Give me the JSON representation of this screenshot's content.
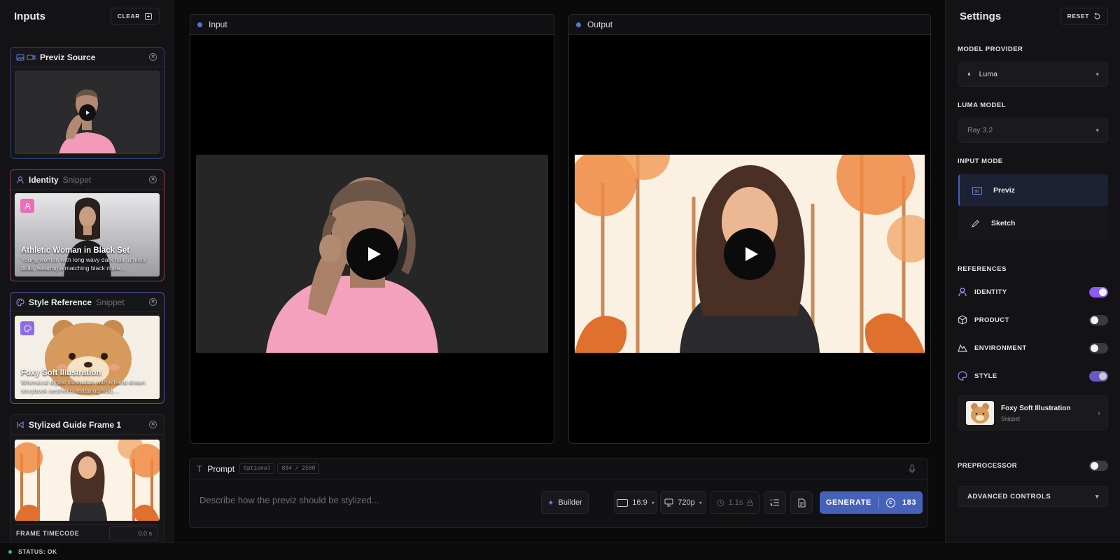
{
  "left": {
    "title": "Inputs",
    "clear_label": "CLEAR",
    "previz_card": {
      "title": "Previz Source"
    },
    "identity_card": {
      "title": "Identity",
      "tag": "Snippet",
      "name": "Athletic Woman in Black Set",
      "desc": "Young woman with long wavy dark hair, athletic build, wearing a matching black ribbe..."
    },
    "style_card": {
      "title": "Style Reference",
      "tag": "Snippet",
      "name": "Foxy Soft Illustration",
      "desc": "Whimsical digital illustration with a hand-drawn storybook aesthetic, featuring fluid,..."
    },
    "guide_card": {
      "title": "Stylized Guide Frame 1",
      "timecode_label": "FRAME TIMECODE",
      "timecode_value": "0.0 s"
    }
  },
  "center": {
    "input_label": "Input",
    "output_label": "Output",
    "prompt": {
      "label": "Prompt",
      "optional": "Optional",
      "counter": "894 / 2500",
      "placeholder": "Describe how the previz should be stylized..."
    },
    "builder_label": "Builder",
    "aspect": "16:9",
    "resolution": "720p",
    "duration": "1.1s",
    "generate_label": "GENERATE",
    "credits": "183"
  },
  "right": {
    "title": "Settings",
    "reset_label": "RESET",
    "model_provider_label": "MODEL PROVIDER",
    "model_provider_value": "Luma",
    "luma_model_label": "LUMA MODEL",
    "luma_model_value": "Ray 3.2",
    "input_mode_label": "INPUT MODE",
    "modes": [
      "Previz",
      "Sketch"
    ],
    "references_label": "REFERENCES",
    "refs": [
      {
        "label": "IDENTITY",
        "on": true
      },
      {
        "label": "PRODUCT",
        "on": false
      },
      {
        "label": "ENVIRONMENT",
        "on": false
      },
      {
        "label": "STYLE",
        "on": true
      }
    ],
    "style_snippet": {
      "name": "Foxy Soft Illustration",
      "tag": "Snippet"
    },
    "preprocessor_label": "PREPROCESSOR",
    "advanced_label": "ADVANCED CONTROLS"
  },
  "status": {
    "text": "STATUS: OK"
  },
  "colors": {
    "accent": "#4562b8",
    "toggle_on": "#8b5cf6",
    "identity_border": "#8a3a55",
    "style_border": "#4a4fa8",
    "previz_border": "#2d3f78"
  }
}
